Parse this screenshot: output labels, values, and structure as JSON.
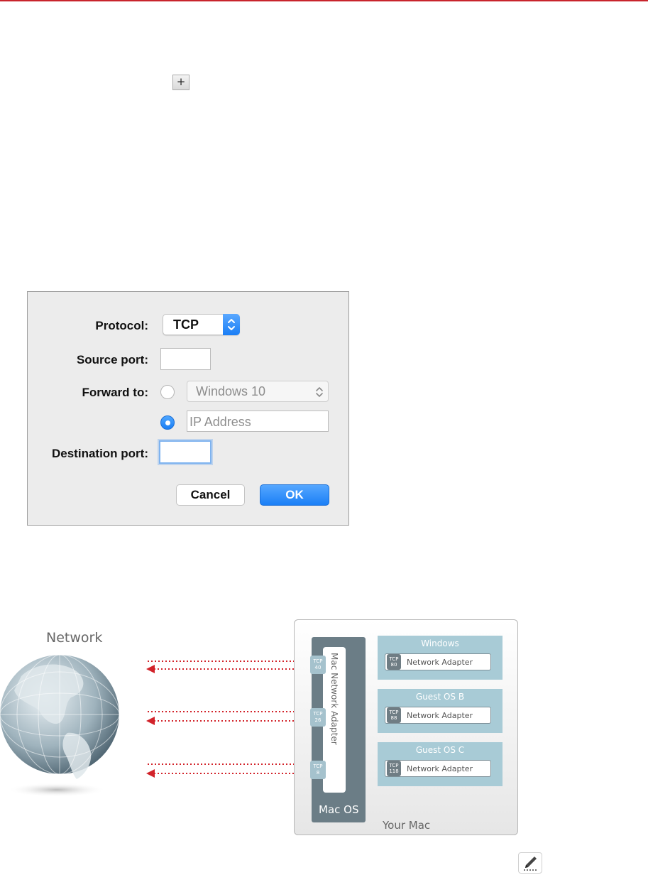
{
  "colors": {
    "accent_red": "#c8242c",
    "mac_blue": "#1a7ef5",
    "guest_panel": "#a8cbd6",
    "macos_column": "#6b7d86",
    "arrow_red": "#d2232a"
  },
  "toolbar": {
    "plus_label": "+"
  },
  "dialog": {
    "protocol_label": "Protocol:",
    "protocol_value": "TCP",
    "source_port_label": "Source port:",
    "source_port_value": "",
    "forward_to_label": "Forward to:",
    "vm_option": "Windows 10",
    "ip_placeholder": "IP Address",
    "destination_port_label": "Destination port:",
    "destination_port_value": "",
    "cancel_label": "Cancel",
    "ok_label": "OK"
  },
  "diagram": {
    "network_label": "Network",
    "your_mac_label": "Your Mac",
    "macos_label": "Mac OS",
    "mac_adapter_label": "Mac Network Adapter",
    "host_ports": [
      {
        "protocol": "TCP",
        "port": "40"
      },
      {
        "protocol": "TCP",
        "port": "26"
      },
      {
        "protocol": "TCP",
        "port": "8"
      }
    ],
    "guests": [
      {
        "name": "Windows",
        "adapter": "Network Adapter",
        "protocol": "TCP",
        "port": "80"
      },
      {
        "name": "Guest OS B",
        "adapter": "Network Adapter",
        "protocol": "TCP",
        "port": "88"
      },
      {
        "name": "Guest OS C",
        "adapter": "Network Adapter",
        "protocol": "TCP",
        "port": "118"
      }
    ]
  },
  "icons": {
    "pencil": "pencil-icon",
    "globe": "globe-icon",
    "popup_arrows": "chevron-updown-icon"
  }
}
